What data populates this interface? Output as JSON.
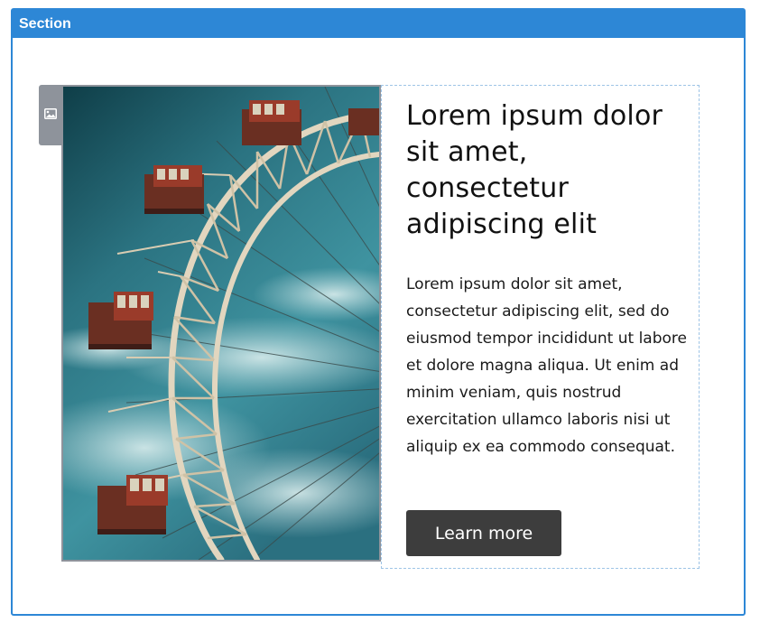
{
  "section": {
    "title": "Section"
  },
  "content": {
    "image_alt": "ferris-wheel-photo",
    "headline": "Lorem ipsum dolor sit amet, consectetur adipiscing elit",
    "body": "Lorem ipsum dolor sit amet, consectetur adipiscing elit, sed do eiusmod tempor incididunt ut labore et dolore magna aliqua. Ut enim ad minim veniam, quis nostrud exercitation ullamco laboris nisi ut aliquip ex ea commodo consequat.",
    "cta_label": "Learn more"
  },
  "icons": {
    "image_tab": "image-icon"
  },
  "colors": {
    "section_accent": "#2d87d6",
    "image_border": "#8e939b",
    "dashed_outline": "#9ec4e6",
    "button_bg": "#3d3d3d"
  }
}
